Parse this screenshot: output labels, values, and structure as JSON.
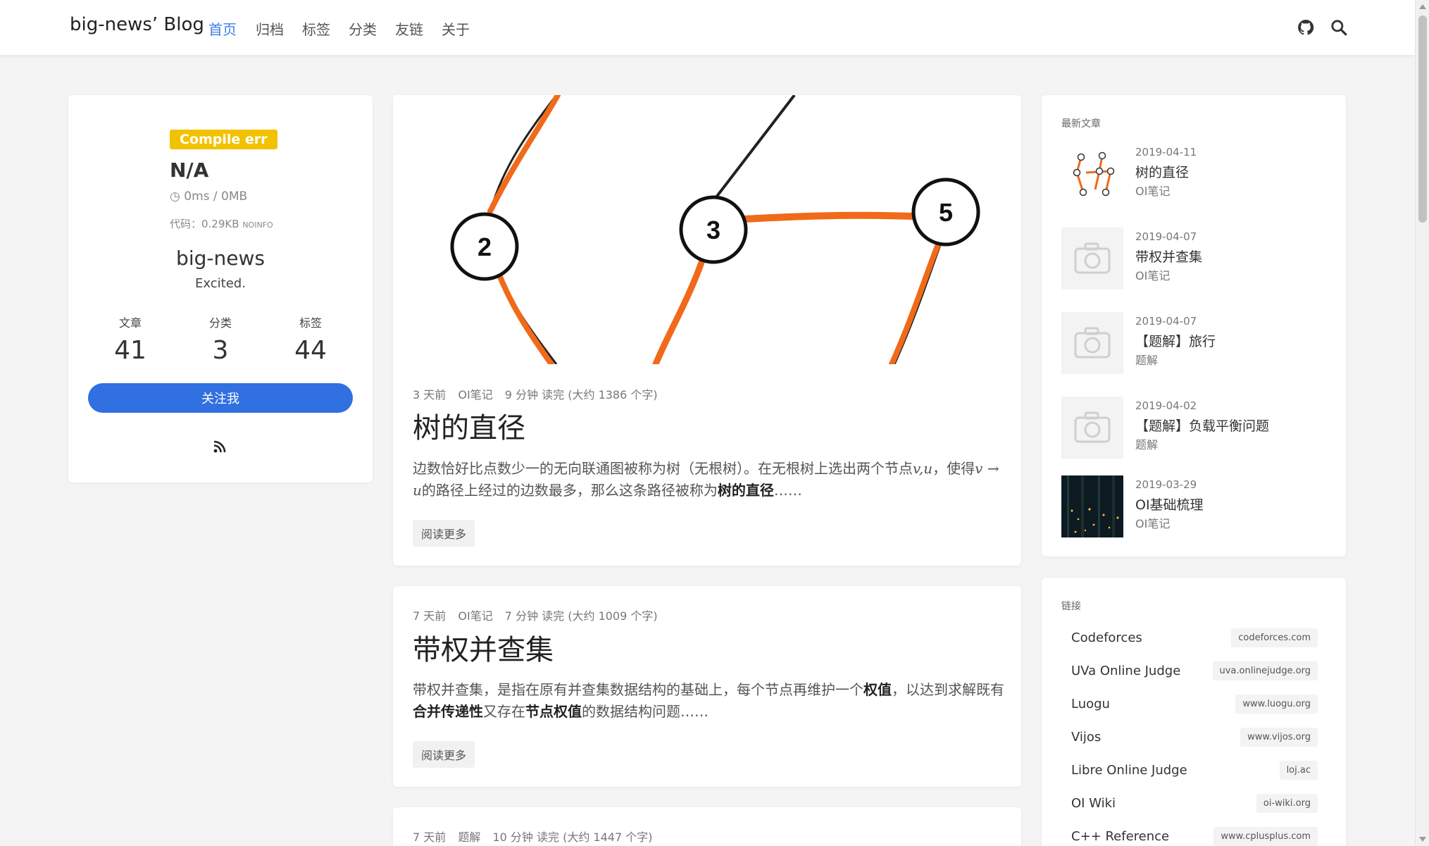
{
  "header": {
    "brand": "big-news’ Blog",
    "nav": [
      "首页",
      "归档",
      "标签",
      "分类",
      "友链",
      "关于"
    ],
    "icons": [
      "github-icon",
      "search-icon"
    ],
    "accent_color": "#3b7de9"
  },
  "profile": {
    "badge": "Compile err",
    "score": "N/A",
    "time_mem": "0ms / 0MB",
    "code_size": "代码：0.29KB",
    "code_lang": "NOINFO",
    "name": "big-news",
    "desc": "Excited.",
    "stats": [
      {
        "label": "文章",
        "value": "41"
      },
      {
        "label": "分类",
        "value": "3"
      },
      {
        "label": "标签",
        "value": "44"
      }
    ],
    "follow_label": "关注我"
  },
  "posts": [
    {
      "time": "3 天前",
      "category": "OI笔记",
      "read": "9 分钟 读完 (大约 1386 个字)",
      "title": "树的直径",
      "excerpt_a": "边数恰好比点数少一的无向联通图被称为树（无根树）。在无根树上选出两个节点",
      "excerpt_math1": "v,u",
      "excerpt_b": "，使得",
      "excerpt_math2": "v → u",
      "excerpt_c": "的路径上经过的边数最多，那么这条路径被称为",
      "excerpt_bold": "树的直径",
      "excerpt_d": "……",
      "read_more": "阅读更多",
      "cover_nodes": [
        "2",
        "3",
        "5"
      ]
    },
    {
      "time": "7 天前",
      "category": "OI笔记",
      "read": "7 分钟 读完 (大约 1009 个字)",
      "title": "带权并查集",
      "excerpt_a": "带权并查集，是指在原有并查集数据结构的基础上，每个节点再维护一个",
      "excerpt_bold1": "权值",
      "excerpt_b": "，以达到求解既有",
      "excerpt_bold2": "合并传递性",
      "excerpt_c": "又存在",
      "excerpt_bold3": "节点权值",
      "excerpt_d": "的数据结构问题……",
      "read_more": "阅读更多"
    },
    {
      "time": "7 天前",
      "category": "题解",
      "read": "10 分钟 读完 (大约 1447 个字)"
    }
  ],
  "recent": {
    "title": "最新文章",
    "items": [
      {
        "date": "2019-04-11",
        "title": "树的直径",
        "category": "OI笔记",
        "thumb": "tree-diagram"
      },
      {
        "date": "2019-04-07",
        "title": "带权并查集",
        "category": "OI笔记",
        "thumb": "camera-placeholder-icon"
      },
      {
        "date": "2019-04-07",
        "title": "【题解】旅行",
        "category": "题解",
        "thumb": "camera-placeholder-icon"
      },
      {
        "date": "2019-04-02",
        "title": "【题解】负载平衡问题",
        "category": "题解",
        "thumb": "camera-placeholder-icon"
      },
      {
        "date": "2019-03-29",
        "title": "OI基础梳理",
        "category": "OI笔记",
        "thumb": "firefly-photo"
      }
    ]
  },
  "links": {
    "title": "链接",
    "items": [
      {
        "name": "Codeforces",
        "domain": "codeforces.com"
      },
      {
        "name": "UVa Online Judge",
        "domain": "uva.onlinejudge.org"
      },
      {
        "name": "Luogu",
        "domain": "www.luogu.org"
      },
      {
        "name": "Vijos",
        "domain": "www.vijos.org"
      },
      {
        "name": "Libre Online Judge",
        "domain": "loj.ac"
      },
      {
        "name": "OI Wiki",
        "domain": "oi-wiki.org"
      },
      {
        "name": "C++ Reference",
        "domain": "www.cplusplus.com"
      }
    ]
  }
}
